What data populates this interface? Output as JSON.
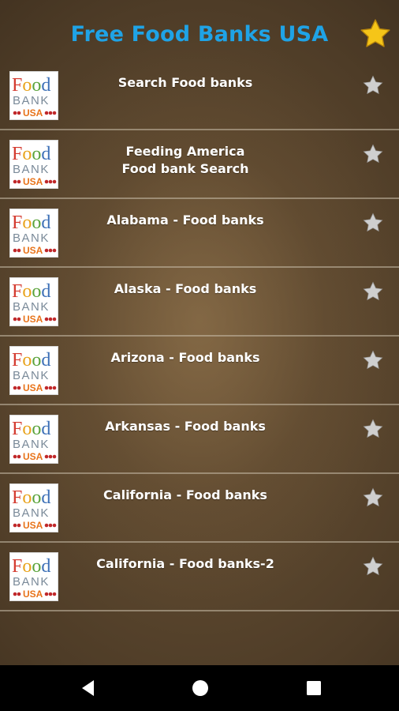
{
  "app": {
    "title": "Free Food Banks USA"
  },
  "colors": {
    "title": "#1fa3e6",
    "star_gold": "#f5c518",
    "star_gray": "#c8c8c8",
    "divider": "#c8beaa"
  },
  "icons": {
    "favorites": "star-icon",
    "row_favorite": "star-outline-icon",
    "row_thumbnail": "food-bank-usa-logo"
  },
  "list": {
    "items": [
      {
        "label": "Search Food banks"
      },
      {
        "label": "Feeding America\nFood bank Search"
      },
      {
        "label": "Alabama  - Food banks"
      },
      {
        "label": "Alaska  - Food banks"
      },
      {
        "label": "Arizona  - Food banks"
      },
      {
        "label": "Arkansas  - Food banks"
      },
      {
        "label": "California  - Food banks"
      },
      {
        "label": "California  - Food banks-2"
      }
    ]
  },
  "logo": {
    "line1": "Food",
    "line2": "BANK",
    "line3": "USA"
  },
  "navbar": {
    "back": "back-icon",
    "home": "home-icon",
    "recents": "recents-icon"
  }
}
